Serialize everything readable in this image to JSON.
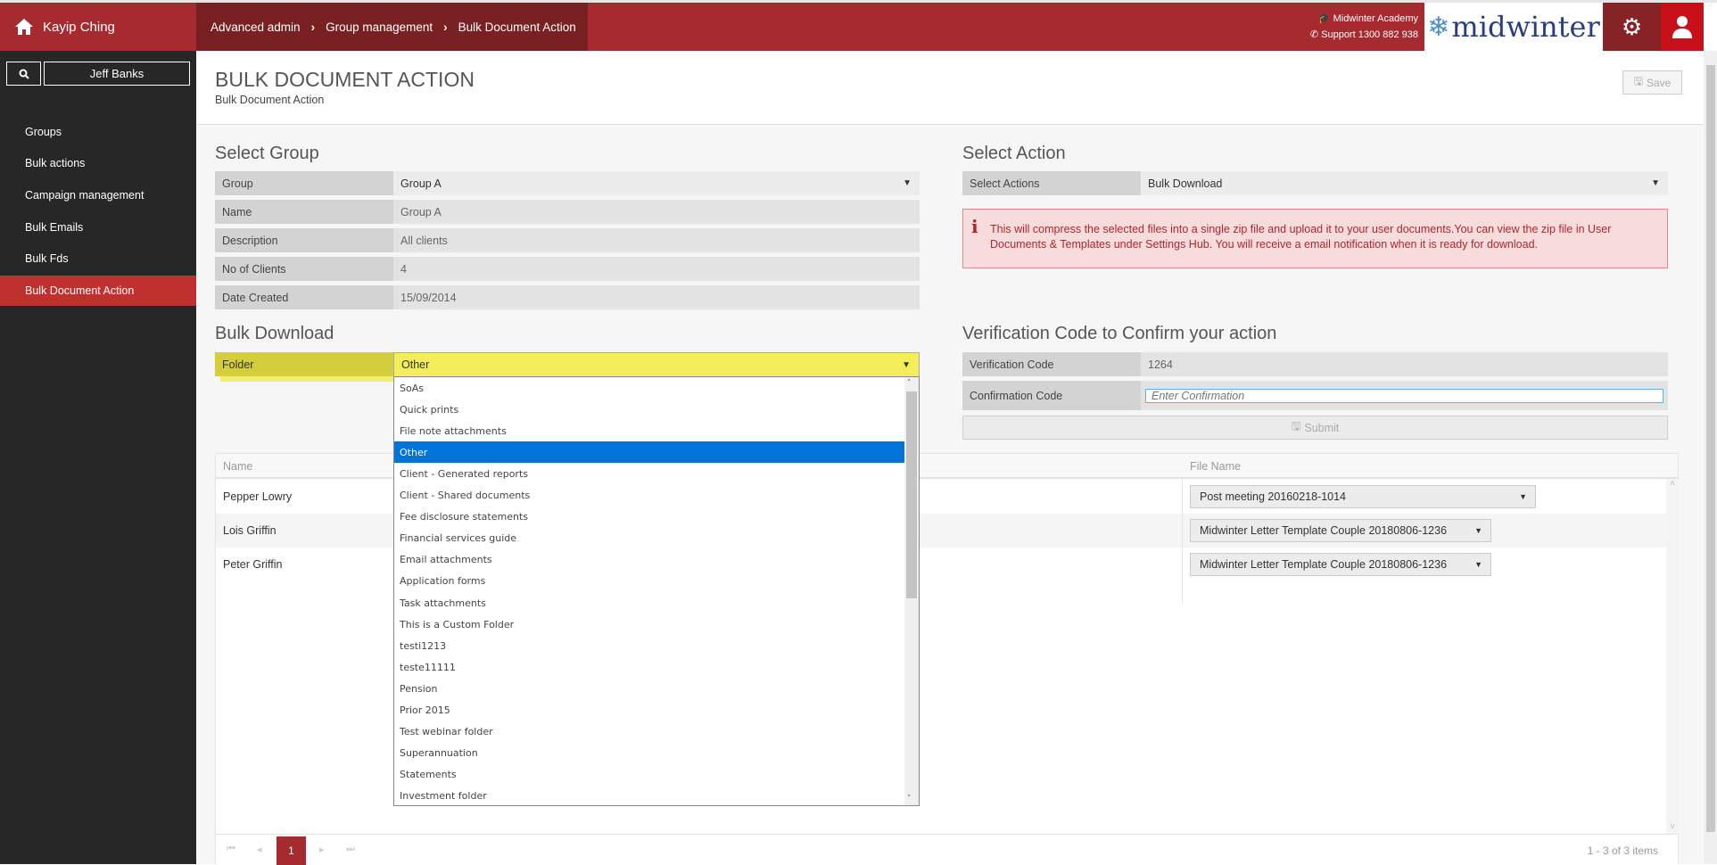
{
  "header": {
    "user_name": "Kayip Ching",
    "breadcrumb": [
      "Advanced admin",
      "Group management",
      "Bulk Document Action"
    ],
    "academy": "Midwinter Academy",
    "support": "Support 1300 882 938",
    "logo": "midwinter",
    "colors": {
      "brand_red": "#a52b30",
      "breadcrumb_bg": "#792022",
      "accent_blue": "#0074d9"
    }
  },
  "sidebar": {
    "search_user": "Jeff Banks",
    "items": [
      {
        "label": "Groups"
      },
      {
        "label": "Bulk actions"
      },
      {
        "label": "Campaign management"
      },
      {
        "label": "Bulk Emails"
      },
      {
        "label": "Bulk Fds"
      },
      {
        "label": "Bulk Document Action",
        "active": true
      }
    ]
  },
  "page": {
    "title": "BULK DOCUMENT ACTION",
    "subtitle": "Bulk Document Action",
    "save_label": "Save"
  },
  "select_group": {
    "heading": "Select Group",
    "group_label": "Group",
    "group_value": "Group A",
    "name_label": "Name",
    "name_value": "Group A",
    "description_label": "Description",
    "description_value": "All clients",
    "clients_label": "No of Clients",
    "clients_value": "4",
    "date_label": "Date Created",
    "date_value": "15/09/2014"
  },
  "select_action": {
    "heading": "Select Action",
    "label": "Select Actions",
    "value": "Bulk Download",
    "alert": "This will compress the selected files into a single zip file and upload it to your user documents.You can view the zip file in User Documents & Templates under Settings Hub. You will receive a email notification when it is ready for download."
  },
  "bulk_download": {
    "heading": "Bulk Download",
    "folder_label": "Folder",
    "folder_value": "Other",
    "folder_options": [
      "SoAs",
      "Quick prints",
      "File note attachments",
      "Other",
      "Client - Generated reports",
      "Client - Shared documents",
      "Fee disclosure statements",
      "Financial services guide",
      "Email attachments",
      "Application forms",
      "Task attachments",
      "This is a Custom Folder",
      "testi1213",
      "teste11111",
      "Pension",
      "Prior 2015",
      "Test webinar folder",
      "Superannuation",
      "Statements",
      "Investment folder"
    ]
  },
  "verification": {
    "heading": "Verification Code to Confirm your action",
    "code_label": "Verification Code",
    "code_value": "1264",
    "confirm_label": "Confirmation Code",
    "confirm_placeholder": "Enter Confirmation",
    "submit_label": "Submit"
  },
  "table": {
    "columns": [
      "Name",
      "File Name"
    ],
    "rows": [
      {
        "name": "Pepper Lowry",
        "file": "Post meeting 20160218-1014"
      },
      {
        "name": "Lois Griffin",
        "file": "Midwinter Letter Template Couple 20180806-1236"
      },
      {
        "name": "Peter Griffin",
        "file": "Midwinter Letter Template Couple 20180806-1236"
      }
    ],
    "current_page": "1",
    "page_info": "1 - 3 of 3 items"
  }
}
